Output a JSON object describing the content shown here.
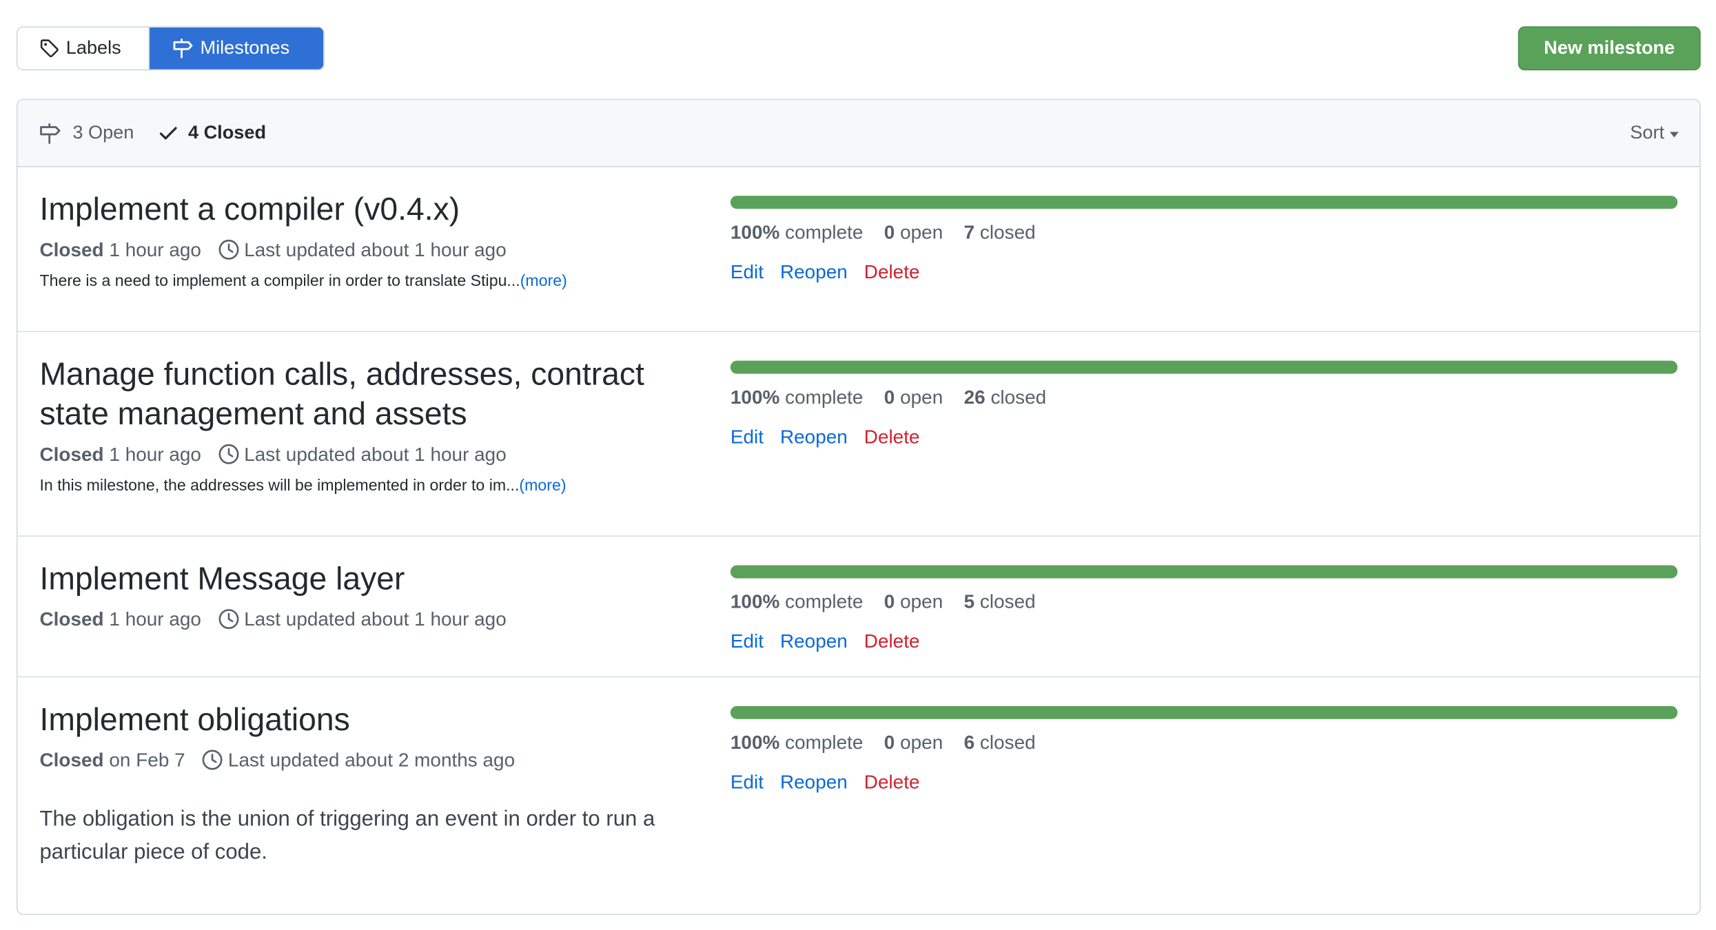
{
  "toolbar": {
    "labels_tab": "Labels",
    "milestones_tab": "Milestones",
    "new_milestone": "New milestone"
  },
  "header": {
    "open_label": "3 Open",
    "closed_label": "4 Closed",
    "sort_label": "Sort"
  },
  "colors": {
    "accent_blue": "#2f70d6",
    "progress_green": "#5aa25a",
    "link_blue": "#0969da",
    "danger_red": "#cf222e"
  },
  "milestones": [
    {
      "title": "Implement a compiler (v0.4.x)",
      "status": "Closed",
      "closed_when": "1 hour ago",
      "updated": "Last updated about 1 hour ago",
      "description": "There is a need to implement a compiler in order to translate Stipu...",
      "more": "(more)",
      "percent": 100,
      "percent_text": "100%",
      "complete_word": "complete",
      "open_count": "0",
      "open_word": "open",
      "closed_count": "7",
      "closed_word": "closed",
      "actions": {
        "edit": "Edit",
        "reopen": "Reopen",
        "delete": "Delete"
      }
    },
    {
      "title_line1": "Manage function calls, addresses, contract",
      "title_line2": "state management and assets",
      "status": "Closed",
      "closed_when": "1 hour ago",
      "updated": "Last updated about 1 hour ago",
      "description": "In this milestone, the addresses will be implemented in order to im...",
      "more": "(more)",
      "percent": 100,
      "percent_text": "100%",
      "complete_word": "complete",
      "open_count": "0",
      "open_word": "open",
      "closed_count": "26",
      "closed_word": "closed",
      "actions": {
        "edit": "Edit",
        "reopen": "Reopen",
        "delete": "Delete"
      }
    },
    {
      "title": "Implement Message layer",
      "status": "Closed",
      "closed_when": "1 hour ago",
      "updated": "Last updated about 1 hour ago",
      "percent": 100,
      "percent_text": "100%",
      "complete_word": "complete",
      "open_count": "0",
      "open_word": "open",
      "closed_count": "5",
      "closed_word": "closed",
      "actions": {
        "edit": "Edit",
        "reopen": "Reopen",
        "delete": "Delete"
      }
    },
    {
      "title": "Implement obligations",
      "status": "Closed",
      "closed_when": "on Feb 7",
      "updated": "Last updated about 2 months ago",
      "description": "The obligation is the union of triggering an event in order to run a particular piece of code.",
      "percent": 100,
      "percent_text": "100%",
      "complete_word": "complete",
      "open_count": "0",
      "open_word": "open",
      "closed_count": "6",
      "closed_word": "closed",
      "actions": {
        "edit": "Edit",
        "reopen": "Reopen",
        "delete": "Delete"
      }
    }
  ]
}
